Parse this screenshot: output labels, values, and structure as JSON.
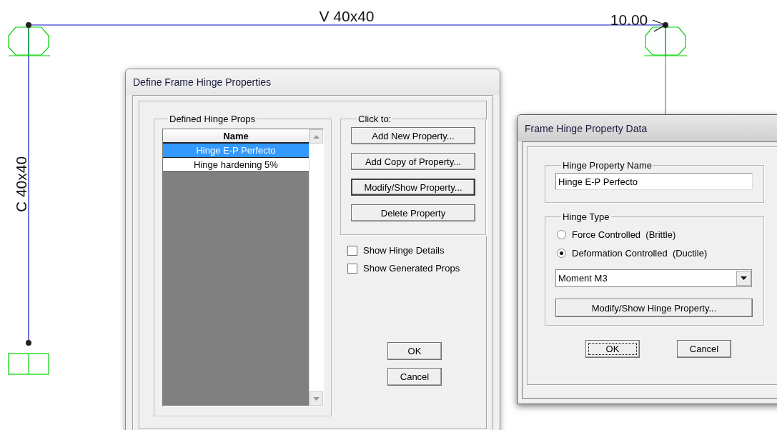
{
  "canvas": {
    "beam_label": "V 40x40",
    "column_label": "C 40x40",
    "dimension": "10.00"
  },
  "define_dialog": {
    "title": "Define Frame Hinge Properties",
    "list_group": "Defined Hinge Props",
    "list": {
      "columns": [
        "Name"
      ],
      "rows": [
        {
          "name": "Hinge E-P Perfecto",
          "selected": true
        },
        {
          "name": "Hinge hardening 5%",
          "selected": false
        }
      ]
    },
    "actions_group": "Click to:",
    "actions": [
      {
        "label": "Add New Property...",
        "default": false
      },
      {
        "label": "Add Copy of Property...",
        "default": false
      },
      {
        "label": "Modify/Show Property...",
        "default": true
      },
      {
        "label": "Delete Property",
        "default": false
      }
    ],
    "options": [
      {
        "label": "Show Hinge Details",
        "checked": false
      },
      {
        "label": "Show Generated Props",
        "checked": false
      }
    ],
    "buttons": [
      {
        "label": "OK",
        "focused": false
      },
      {
        "label": "Cancel",
        "focused": false
      }
    ]
  },
  "data_dialog": {
    "title": "Frame Hinge Property Data",
    "name_group": "Hinge Property Name",
    "name_value": "Hinge E-P Perfecto",
    "type_group": "Hinge Type",
    "types": [
      {
        "label": "Force Controlled  (Brittle)",
        "selected": false
      },
      {
        "label": "Deformation Controlled  (Ductile)",
        "selected": true
      }
    ],
    "component": "Moment M3",
    "modify_button": "Modify/Show Hinge Property...",
    "buttons": [
      {
        "label": "OK",
        "focused": true
      },
      {
        "label": "Cancel",
        "focused": false
      }
    ]
  }
}
